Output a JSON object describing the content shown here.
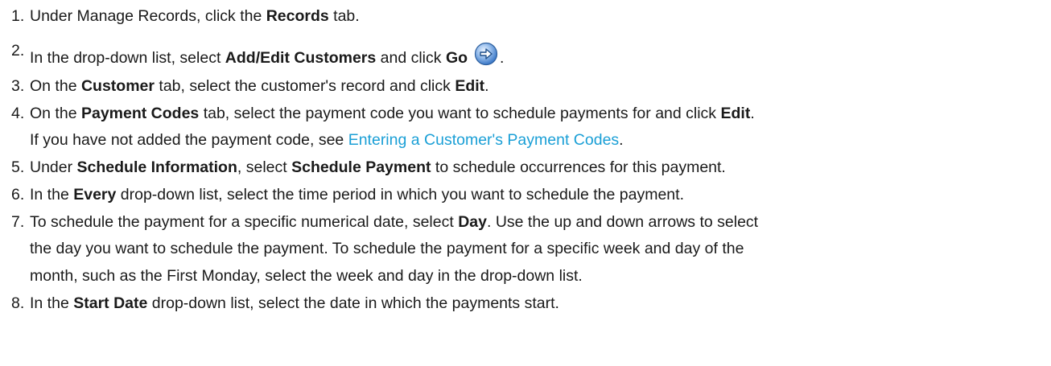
{
  "steps": [
    {
      "number": "1.",
      "t1": "Under Manage Records, click the ",
      "b1": "Records",
      "t2": " tab."
    },
    {
      "number": "2.",
      "t1": "In the drop-down list, select ",
      "b1": "Add/Edit Customers",
      "t2": " and click ",
      "b2": "Go",
      "icon": "go-arrow-icon",
      "t3": "."
    },
    {
      "number": "3.",
      "t1": "On the ",
      "b1": "Customer",
      "t2": " tab, select the customer's record and click ",
      "b2": "Edit",
      "t3": "."
    },
    {
      "number": "4.",
      "t1": "On the ",
      "b1": "Payment Codes",
      "t2": " tab, select the payment code you want to schedule payments for and click ",
      "b2": "Edit",
      "t3": ".",
      "l2_t1": "If you have not added the payment code, see ",
      "link": "Entering a Customer's Payment Codes",
      "l2_t2": "."
    },
    {
      "number": "5.",
      "t1": "Under ",
      "b1": "Schedule Information",
      "t2": ", select ",
      "b2": "Schedule Payment",
      "t3": " to schedule occurrences for this payment."
    },
    {
      "number": "6.",
      "t1": "In the ",
      "b1": "Every",
      "t2": " drop-down list, select the time period in which you want to schedule the payment."
    },
    {
      "number": "7.",
      "t1": "To schedule the payment for a specific numerical date, select ",
      "b1": "Day",
      "t2": ". Use the up and down arrows to select",
      "l2": "the day you want to schedule the payment. To schedule the payment for a specific week and day of the",
      "l3": "month, such as the First Monday, select the week and day in the drop-down list."
    },
    {
      "number": "8.",
      "t1": "In the ",
      "b1": "Start Date",
      "t2": " drop-down list, select the date in which the payments start."
    }
  ],
  "colors": {
    "text": "#1a1a1a",
    "link": "#1a9fd6",
    "icon_blue": "#3a78c8"
  }
}
